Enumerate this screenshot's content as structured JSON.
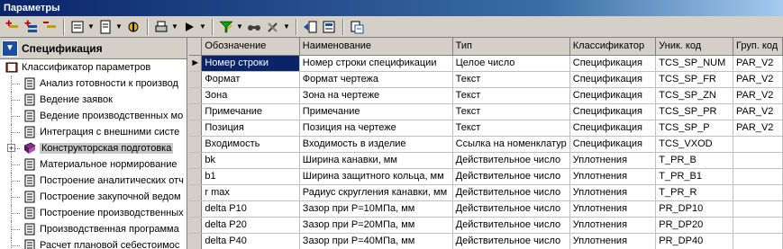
{
  "window": {
    "title": "Параметры"
  },
  "left_panel": {
    "title": "Спецификация",
    "items": [
      {
        "label": "Классификатор параметров",
        "level": 0
      },
      {
        "label": "Анализ готовности к производ",
        "level": 1
      },
      {
        "label": "Ведение заявок",
        "level": 1
      },
      {
        "label": "Ведение производственных мо",
        "level": 1
      },
      {
        "label": "Интеграция с внешними систе",
        "level": 1
      },
      {
        "label": "Конструкторская подготовка",
        "level": 1,
        "selected": true,
        "expander": "+"
      },
      {
        "label": "Материальное нормирование",
        "level": 1
      },
      {
        "label": "Построение аналитических отч",
        "level": 1
      },
      {
        "label": "Построение закупочной ведом",
        "level": 1
      },
      {
        "label": "Построение производственных",
        "level": 1
      },
      {
        "label": "Производственная программа",
        "level": 1
      },
      {
        "label": "Расчет плановой себестоимос",
        "level": 1
      }
    ]
  },
  "grid": {
    "columns": [
      "Обозначение",
      "Наименование",
      "Тип",
      "Классификатор",
      "Уник. код",
      "Груп. код"
    ],
    "rows": [
      [
        "Номер строки",
        "Номер строки спецификации",
        "Целое число",
        "Спецификация",
        "TCS_SP_NUM",
        "PAR_V2"
      ],
      [
        "Формат",
        "Формат чертежа",
        "Текст",
        "Спецификация",
        "TCS_SP_FR",
        "PAR_V2"
      ],
      [
        "Зона",
        "Зона на чертеже",
        "Текст",
        "Спецификация",
        "TCS_SP_ZN",
        "PAR_V2"
      ],
      [
        "Примечание",
        "Примечание",
        "Текст",
        "Спецификация",
        "TCS_SP_PR",
        "PAR_V2"
      ],
      [
        "Позиция",
        "Позиция на чертеже",
        "Текст",
        "Спецификация",
        "TCS_SP_P",
        "PAR_V2"
      ],
      [
        "Входимость",
        "Входимость в изделие",
        "Ссылка на номенклатур",
        "Спецификация",
        "TCS_VXOD",
        ""
      ],
      [
        "bk",
        "Ширина канавки, мм",
        "Действительное число",
        "Уплотнения",
        "T_PR_B",
        ""
      ],
      [
        "b1",
        "Ширина защитного кольца, мм",
        "Действительное число",
        "Уплотнения",
        "T_PR_B1",
        ""
      ],
      [
        "r max",
        "Радиус скругления канавки, мм",
        "Действительное число",
        "Уплотнения",
        "T_PR_R",
        ""
      ],
      [
        "delta P10",
        "Зазор при Р=10МПа, мм",
        "Действительное число",
        "Уплотнения",
        "PR_DP10",
        ""
      ],
      [
        "delta P20",
        "Зазор при Р=20МПа, мм",
        "Действительное число",
        "Уплотнения",
        "PR_DP20",
        ""
      ],
      [
        "delta P40",
        "Зазор при Р=40МПа, мм",
        "Действительное число",
        "Уплотнения",
        "PR_DP40",
        ""
      ]
    ],
    "current_row_marker": "►"
  },
  "toolbar": {
    "icons": [
      "add-icon",
      "add-child-icon",
      "delete-icon",
      "view-icon",
      "document-icon",
      "properties-icon",
      "print-icon",
      "run-icon",
      "filter-icon",
      "find-icon",
      "tools-icon",
      "move-icon",
      "import-icon",
      "refresh-icon"
    ]
  }
}
